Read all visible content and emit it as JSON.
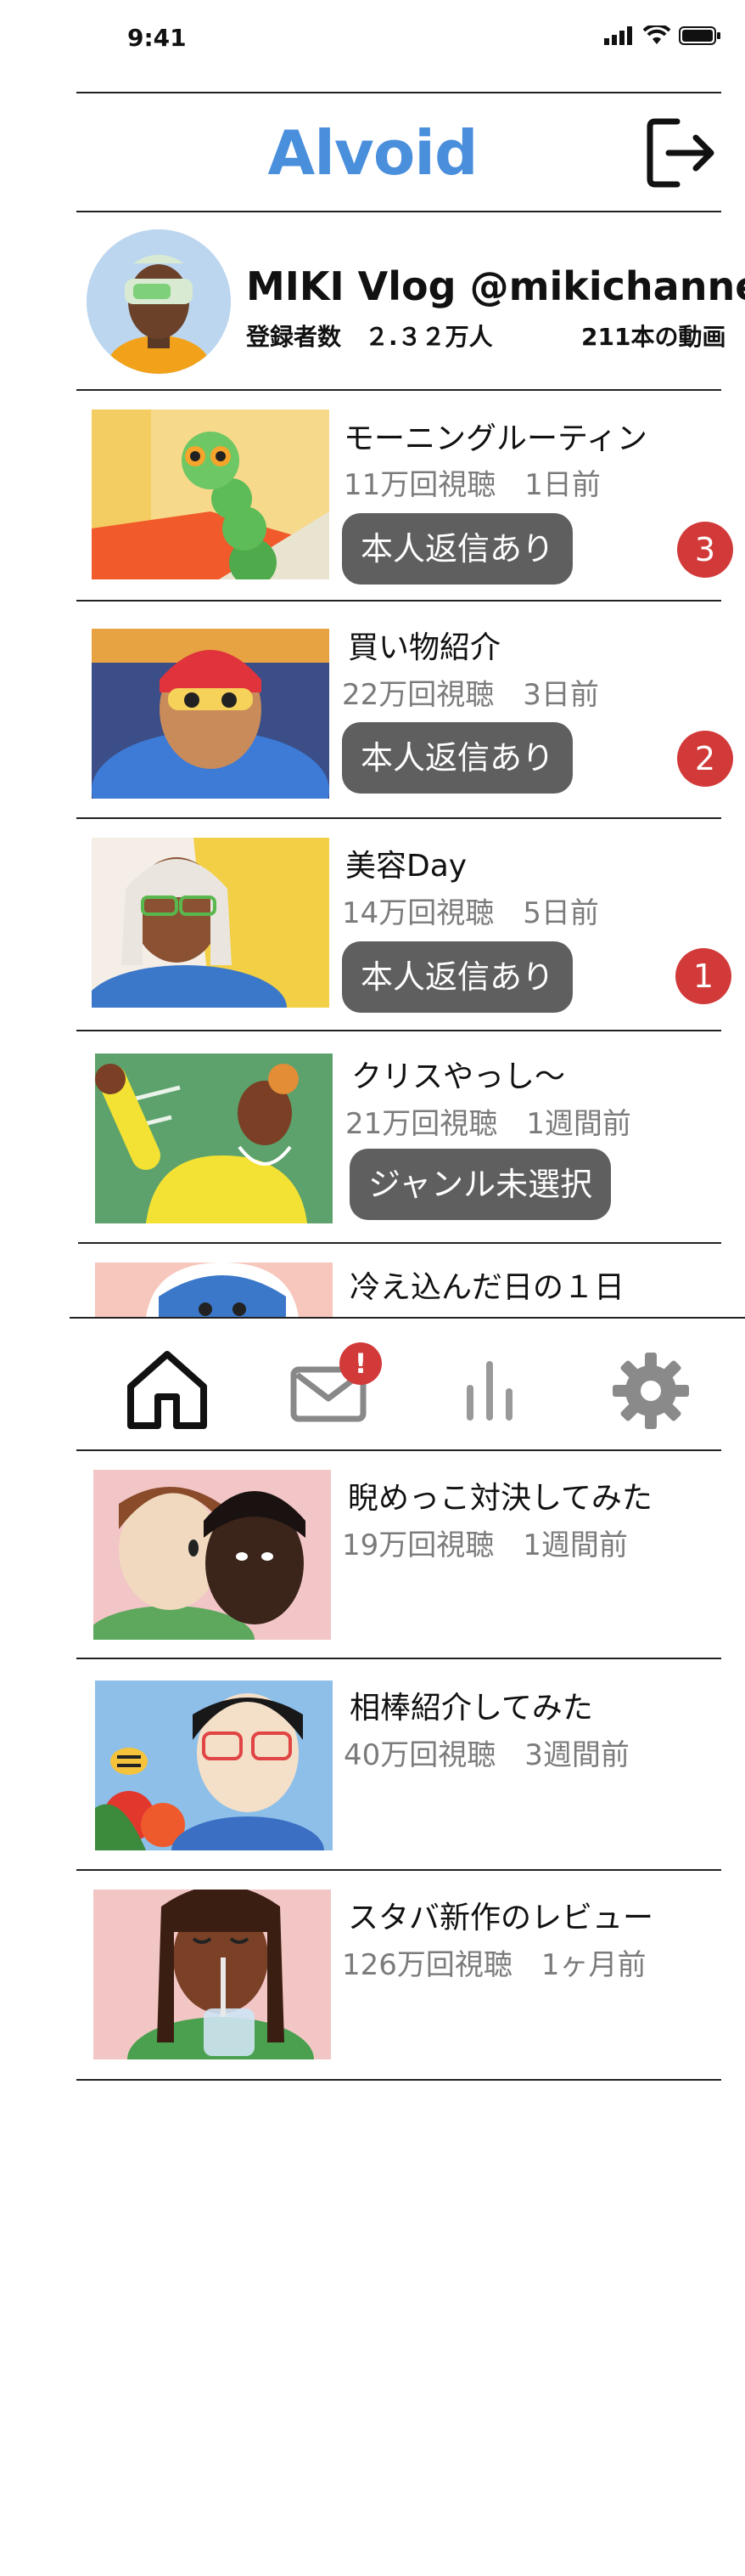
{
  "status_bar": {
    "time": "9:41"
  },
  "app": {
    "title": "Alvoid"
  },
  "profile": {
    "name": "MIKI Vlog @mikichannel",
    "subscribers": "登録者数　２.３２万人",
    "video_count": "211本の動画"
  },
  "videos": [
    {
      "title": "モーニングルーティン",
      "meta": "11万回視聴　1日前",
      "tag": "本人返信あり",
      "badge": "3"
    },
    {
      "title": "買い物紹介",
      "meta": "22万回視聴　3日前",
      "tag": "本人返信あり",
      "badge": "2"
    },
    {
      "title": "美容Day",
      "meta": "14万回視聴　5日前",
      "tag": "本人返信あり",
      "badge": "1"
    },
    {
      "title": "クリスやっし〜",
      "meta": "21万回視聴　1週間前",
      "tag": "ジャンル未選択"
    },
    {
      "title": "冷え込んだ日の１日"
    },
    {
      "title": "睨めっこ対決してみた",
      "meta": "19万回視聴　1週間前"
    },
    {
      "title": "相棒紹介してみた",
      "meta": "40万回視聴　3週間前"
    },
    {
      "title": "スタバ新作のレビュー",
      "meta": "126万回視聴　1ヶ月前"
    }
  ],
  "tabbar": {
    "mail_badge": "!",
    "icons": [
      "home-icon",
      "mail-icon",
      "analytics-icon",
      "gear-icon"
    ]
  },
  "colors": {
    "brand": "#4a8fdc",
    "badge": "#d23a3a",
    "pill": "#5f5f5f",
    "meta_text": "#7b7b7b"
  }
}
